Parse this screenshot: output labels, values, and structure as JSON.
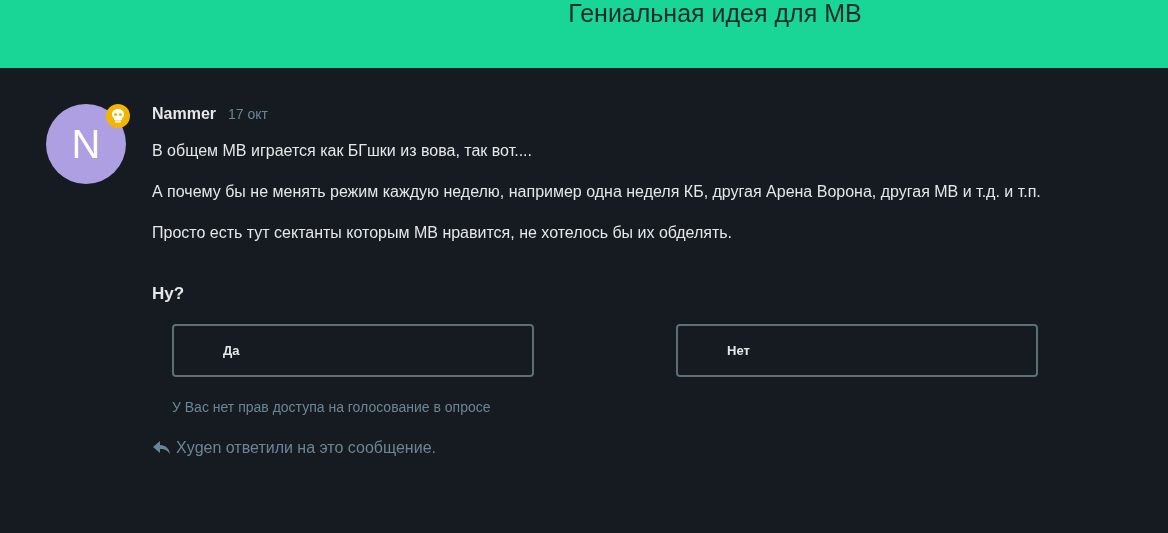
{
  "header": {
    "title": "Гениальная идея для МВ"
  },
  "post": {
    "avatar_letter": "N",
    "author": "Nammer",
    "date": "17 окт",
    "paragraphs": [
      "В общем МВ играется как БГшки из вова, так вот....",
      "А почему бы не менять режим каждую неделю, например одна неделя КБ, другая Арена Ворона, другая МВ и т.д. и т.п.",
      "Просто есть тут сектанты которым МВ нравится, не хотелось бы их обделять."
    ]
  },
  "poll": {
    "question": "Ну?",
    "options": [
      {
        "label": "Да"
      },
      {
        "label": "Нет"
      }
    ],
    "note": "У Вас нет прав доступа на голосование в опросе"
  },
  "replies": {
    "text": "Xygen ответили на это сообщение."
  }
}
